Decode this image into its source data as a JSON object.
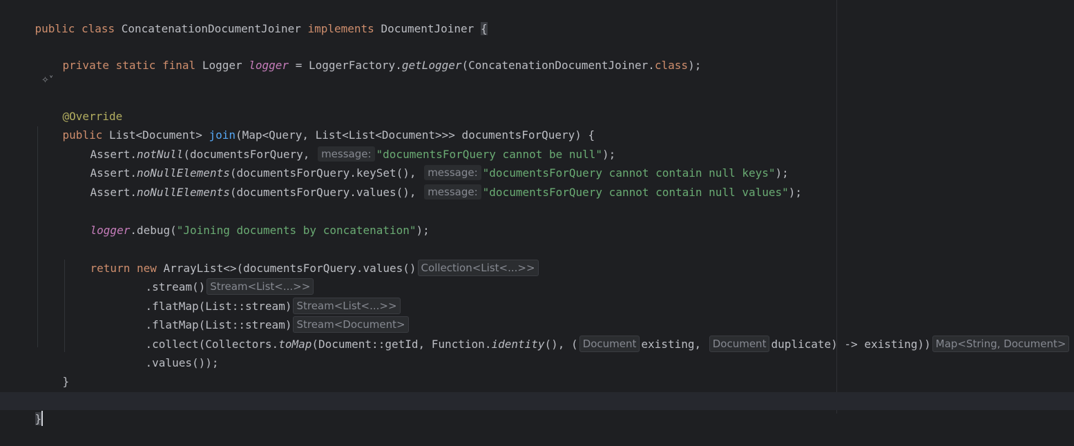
{
  "editor": {
    "line1": {
      "t1": "public class ",
      "t2": "ConcatenationDocumentJoiner ",
      "t3": "implements ",
      "t4": "DocumentJoiner ",
      "t5": "{"
    },
    "line2": {
      "t1": "private static final ",
      "t2": "Logger ",
      "t3": "logger",
      "t4": " = LoggerFactory.",
      "t5": "getLogger",
      "t6": "(ConcatenationDocumentJoiner.",
      "t7": "class",
      "t8": ");"
    },
    "ai_icon": {
      "glyph": "✧",
      "chevron": "˅"
    },
    "line3": {
      "t1": "@Override"
    },
    "line4": {
      "t1": "public ",
      "t2": "List<Document> ",
      "t3": "join",
      "t4": "(Map<Query, List<List<Document>>> documentsForQuery) {"
    },
    "line5": {
      "t1": "Assert.",
      "t2": "notNull",
      "t3": "(documentsForQuery, ",
      "hint": "message:",
      "t4": "\"documentsForQuery cannot be null\"",
      "t5": ");"
    },
    "line6": {
      "t1": "Assert.",
      "t2": "noNullElements",
      "t3": "(documentsForQuery.keySet(), ",
      "hint": "message:",
      "t4": "\"documentsForQuery cannot contain null keys\"",
      "t5": ");"
    },
    "line7": {
      "t1": "Assert.",
      "t2": "noNullElements",
      "t3": "(documentsForQuery.values(), ",
      "hint": "message:",
      "t4": "\"documentsForQuery cannot contain null values\"",
      "t5": ");"
    },
    "line8": {
      "t1": "logger",
      "t2": ".debug(",
      "t3": "\"Joining documents by concatenation\"",
      "t4": ");"
    },
    "line9": {
      "t1": "return new ",
      "t2": "ArrayList<>(documentsForQuery.values()",
      "hint": "Collection<List<...>>"
    },
    "line10": {
      "t1": ".stream()",
      "hint": "Stream<List<...>>"
    },
    "line11": {
      "t1": ".flatMap(List::stream)",
      "hint": "Stream<List<...>>"
    },
    "line12": {
      "t1": ".flatMap(List::stream)",
      "hint": "Stream<Document>"
    },
    "line13": {
      "t1": ".collect(Collectors.",
      "t2": "toMap",
      "t3": "(Document::getId, Function.",
      "t4": "identity",
      "t5": "(), (",
      "hint1": "Document",
      "t6": "existing, ",
      "hint2": "Document",
      "t7": "duplicate) -> existing))",
      "hint3": "Map<String, Document>"
    },
    "line14": {
      "t1": ".values());"
    },
    "line15": {
      "t1": "}"
    },
    "line16": {
      "t1": "}"
    }
  }
}
